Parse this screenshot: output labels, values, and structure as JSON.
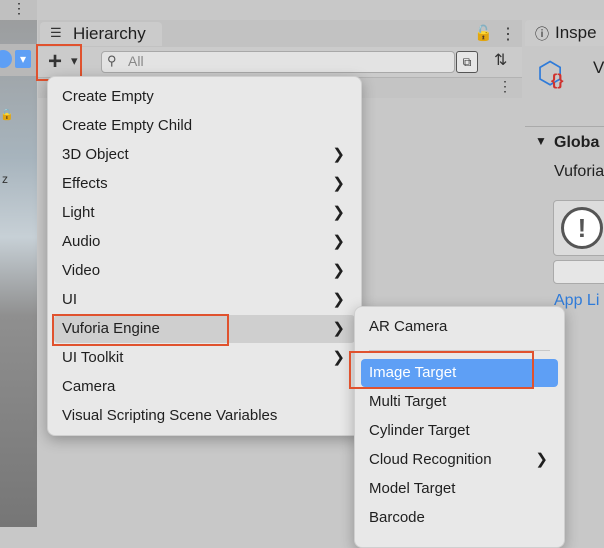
{
  "hierarchy": {
    "tab_label": "Hierarchy",
    "search_placeholder": "All"
  },
  "inspector": {
    "tab_label": "Inspe",
    "title_partial": "V",
    "section_label": "Globa",
    "vuforia_label": "Vuforia",
    "link_label": "App Li"
  },
  "scene": {
    "label_fragment": "z"
  },
  "toolbar": {
    "add_glyph": "+",
    "dropdown_glyph": "▾"
  },
  "main_menu": {
    "items": [
      {
        "label": "Create Empty",
        "submenu": false
      },
      {
        "label": "Create Empty Child",
        "submenu": false
      },
      {
        "label": "3D Object",
        "submenu": true
      },
      {
        "label": "Effects",
        "submenu": true
      },
      {
        "label": "Light",
        "submenu": true
      },
      {
        "label": "Audio",
        "submenu": true
      },
      {
        "label": "Video",
        "submenu": true
      },
      {
        "label": "UI",
        "submenu": true
      },
      {
        "label": "Vuforia Engine",
        "submenu": true
      },
      {
        "label": "UI Toolkit",
        "submenu": true
      },
      {
        "label": "Camera",
        "submenu": false
      },
      {
        "label": "Visual Scripting Scene Variables",
        "submenu": false
      }
    ],
    "highlighted": "Vuforia Engine"
  },
  "sub_menu": {
    "items": [
      {
        "label": "AR Camera",
        "submenu": false
      },
      {
        "label": "Image Target",
        "submenu": false
      },
      {
        "label": "Multi Target",
        "submenu": false
      },
      {
        "label": "Cylinder Target",
        "submenu": false
      },
      {
        "label": "Cloud Recognition",
        "submenu": true
      },
      {
        "label": "Model Target",
        "submenu": false
      },
      {
        "label": "Barcode",
        "submenu": false
      }
    ],
    "selected": "Image Target"
  },
  "colors": {
    "selection_blue": "#5e9ff5",
    "annotation_red": "#e0522e",
    "menu_bg": "#e8e8e8"
  }
}
